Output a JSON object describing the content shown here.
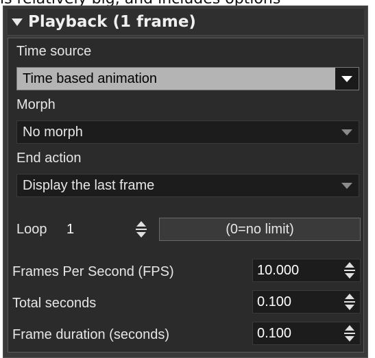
{
  "caption": "is relatively big, and includes options",
  "panel": {
    "title": "Playback (1 frame)",
    "time_source": {
      "label": "Time source",
      "value": "Time based animation"
    },
    "morph": {
      "label": "Morph",
      "value": "No morph"
    },
    "end_action": {
      "label": "End action",
      "value": "Display the last frame"
    },
    "loop": {
      "label": "Loop",
      "value": "1",
      "hint": "(0=no limit)"
    },
    "fps": {
      "label": "Frames Per Second (FPS)",
      "value": "10.000"
    },
    "total_seconds": {
      "label": "Total seconds",
      "value": "0.100"
    },
    "frame_duration": {
      "label": "Frame duration (seconds)",
      "value": "0.100"
    }
  },
  "colors": {
    "panel_bg": "#3a3a3a",
    "field_bg": "#1c1c1c",
    "active_dropdown": "#b4b4b4"
  }
}
